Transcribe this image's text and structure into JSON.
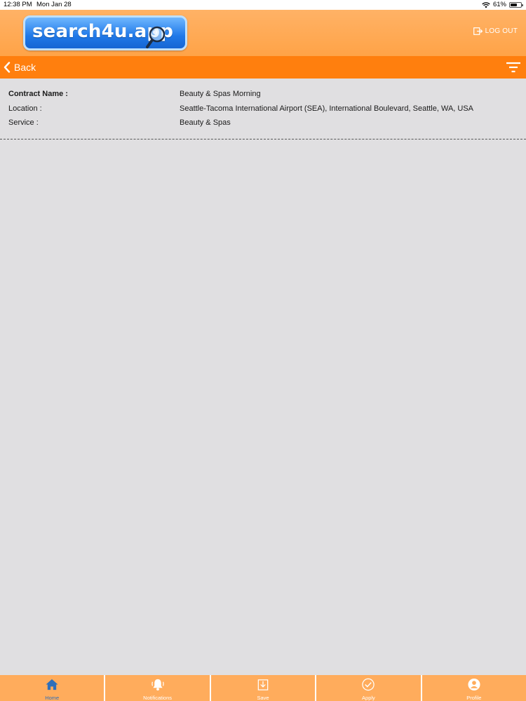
{
  "status_bar": {
    "time": "12:38 PM",
    "date": "Mon Jan 28",
    "battery_percent": "61%",
    "battery_level": 0.61
  },
  "header": {
    "logo_text": "search4u.app",
    "logout_label": "LOG OUT"
  },
  "navbar": {
    "back_label": "Back",
    "filter_icon": "filter-icon"
  },
  "details": {
    "contract_name_label": "Contract Name :",
    "contract_name_value": "Beauty & Spas Morning",
    "location_label": "Location :",
    "location_value": "Seattle-Tacoma International Airport (SEA), International Boulevard, Seattle, WA, USA",
    "service_label": "Service :",
    "service_value": "Beauty & Spas"
  },
  "tabbar": {
    "tabs": [
      {
        "label": "Home",
        "icon": "home-icon",
        "active": true
      },
      {
        "label": "Notifications",
        "icon": "bell-icon",
        "active": false
      },
      {
        "label": "Save",
        "icon": "save-icon",
        "active": false
      },
      {
        "label": "Apply",
        "icon": "check-circle-icon",
        "active": false
      },
      {
        "label": "Profile",
        "icon": "profile-icon",
        "active": false
      }
    ]
  },
  "colors": {
    "header": "#ffa347",
    "navbar": "#ff7f0e",
    "tabbar": "#ffac5c",
    "background": "#e0dfe1",
    "active_tab": "#2f6fba"
  }
}
